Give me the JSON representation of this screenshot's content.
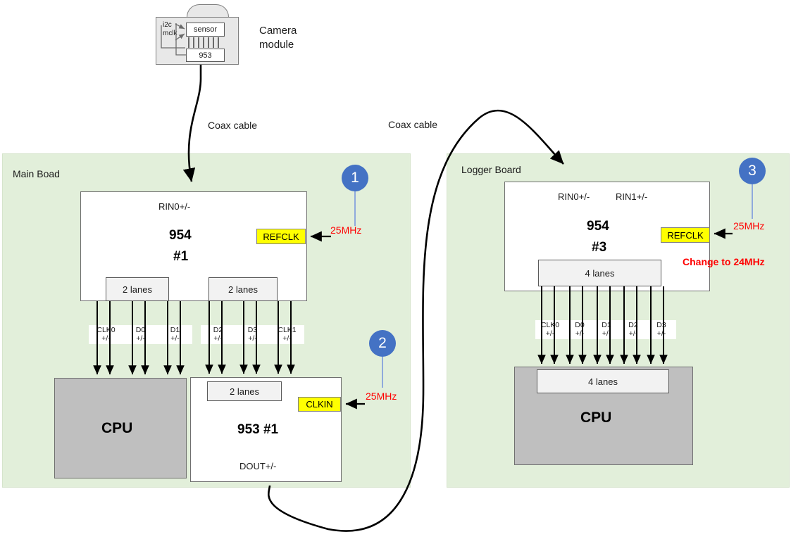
{
  "camera": {
    "caption_line1": "Camera",
    "caption_line2": "module",
    "i2c_label": "i2c",
    "mclk_label": "mclk",
    "sensor_label": "sensor",
    "ser_label": "953"
  },
  "coax": {
    "left_label": "Coax cable",
    "right_label": "Coax cable"
  },
  "main_board": {
    "title": "Main Boad",
    "deser": {
      "rin0": "RIN0+/-",
      "name_line1": "954",
      "name_line2": "#1",
      "refclk": "REFCLK",
      "refclk_freq": "25MHz",
      "lane_left": "2 lanes",
      "lane_right": "2 lanes"
    },
    "signals_left": [
      {
        "name": "CLK0",
        "pol": "+/-"
      },
      {
        "name": "D0",
        "pol": "+/-"
      },
      {
        "name": "D1",
        "pol": "+/-"
      }
    ],
    "signals_right": [
      {
        "name": "D2",
        "pol": "+/-"
      },
      {
        "name": "D3",
        "pol": "+/-"
      },
      {
        "name": "CLK1",
        "pol": "+/-"
      }
    ],
    "cpu": {
      "label": "CPU"
    },
    "ser": {
      "lane_label": "2 lanes",
      "clkin": "CLKIN",
      "clkin_freq": "25MHz",
      "name": "953 #1",
      "dout": "DOUT+/-"
    },
    "badge1": "1",
    "badge2": "2"
  },
  "logger_board": {
    "title": "Logger Board",
    "deser": {
      "rin0": "RIN0+/-",
      "rin1": "RIN1+/-",
      "name_line1": "954",
      "name_line2": "#3",
      "refclk": "REFCLK",
      "refclk_freq": "25MHz",
      "change_note": "Change to 24MHz",
      "lane_label": "4 lanes"
    },
    "signals": [
      {
        "name": "CLK0",
        "pol": "+/-"
      },
      {
        "name": "D0",
        "pol": "+/-"
      },
      {
        "name": "D1",
        "pol": "+/-"
      },
      {
        "name": "D2",
        "pol": "+/-"
      },
      {
        "name": "D3",
        "pol": "+/-"
      }
    ],
    "cpu": {
      "lane_label": "4 lanes",
      "label": "CPU"
    },
    "badge3": "3"
  },
  "colors": {
    "board_green": "#E2EFDA",
    "badge_blue": "#4472C4",
    "badge_stem": "#8FAADC",
    "clock_pad_yellow": "#FFFF00",
    "cpu_gray": "#BFBFBF",
    "annotation_red": "#FF0000"
  }
}
